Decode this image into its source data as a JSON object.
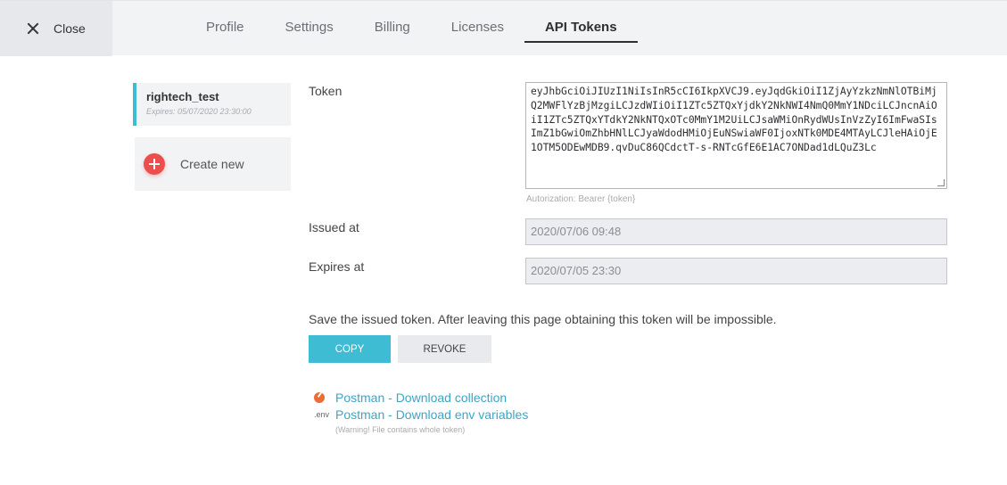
{
  "header": {
    "close_label": "Close",
    "tabs": [
      {
        "label": "Profile",
        "active": false
      },
      {
        "label": "Settings",
        "active": false
      },
      {
        "label": "Billing",
        "active": false
      },
      {
        "label": "Licenses",
        "active": false
      },
      {
        "label": "API Tokens",
        "active": true
      }
    ]
  },
  "sidebar": {
    "token": {
      "name": "rightech_test",
      "expires": "Expires: 05/07/2020 23:30:00"
    },
    "create_label": "Create new"
  },
  "form": {
    "token_label": "Token",
    "token_value": "eyJhbGciOiJIUzI1NiIsInR5cCI6IkpXVCJ9.eyJqdGkiOiI1ZjAyYzkzNmNlOTBiMjQ2MWFlYzBjMzgiLCJzdWIiOiI1ZTc5ZTQxYjdkY2NkNWI4NmQ0MmY1NDciLCJncnAiOiI1ZTc5ZTQxYTdkY2NkNTQxOTc0MmY1M2UiLCJsaWMiOnRydWUsInVzZyI6ImFwaSIsImZ1bGwiOmZhbHNlLCJyaWdodHMiOjEuNSwiaWF0IjoxNTk0MDE4MTAyLCJleHAiOjE1OTM5ODEwMDB9.qvDuC86QCdctT-s-RNTcGfE6E1AC7ONDad1dLQuZ3Lc",
    "token_hint": "Autorization: Bearer {token}",
    "issued_label": "Issued at",
    "issued_value": "2020/07/06 09:48",
    "expires_label": "Expires at",
    "expires_value": "2020/07/05 23:30",
    "warning": "Save the issued token. After leaving this page obtaining this token will be impossible.",
    "copy_label": "COPY",
    "revoke_label": "REVOKE"
  },
  "links": {
    "collection_label": "Postman - Download collection",
    "env_badge": ".env",
    "env_label": "Postman - Download env variables",
    "env_note": "(Warning! File contains whole token)"
  },
  "colors": {
    "accent": "#3dbcd3",
    "danger": "#ec4d4d",
    "link": "#3aa7c4"
  }
}
